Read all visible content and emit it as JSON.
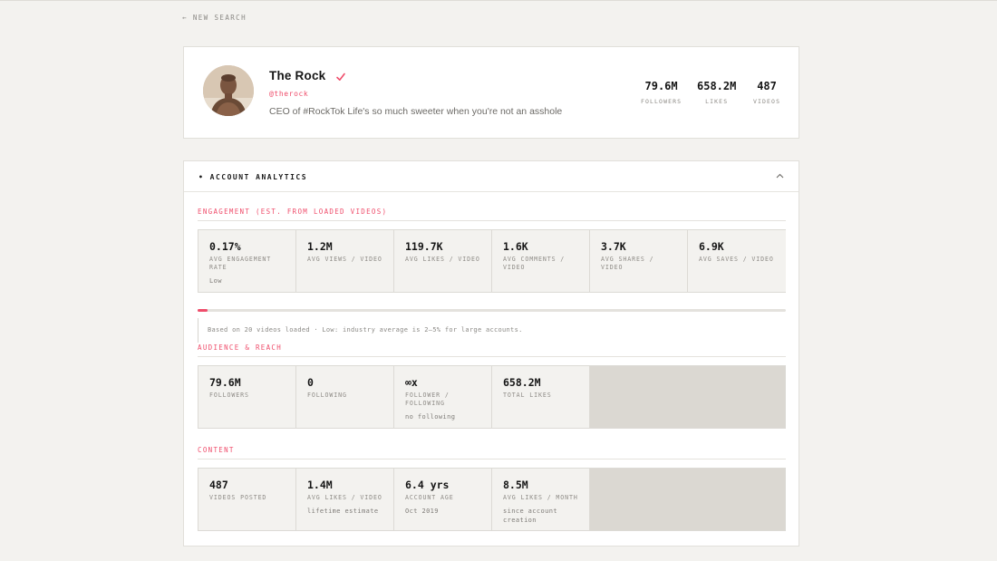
{
  "nav": {
    "back_label": "← NEW SEARCH"
  },
  "profile": {
    "name": "The Rock",
    "handle": "@therock",
    "bio": "CEO of #RockTok Life's so much sweeter when you're not an asshole",
    "verified_icon": "checkmark-icon",
    "stats": [
      {
        "value": "79.6M",
        "label": "FOLLOWERS"
      },
      {
        "value": "658.2M",
        "label": "LIKES"
      },
      {
        "value": "487",
        "label": "VIDEOS"
      }
    ]
  },
  "analytics": {
    "title": "• ACCOUNT ANALYTICS",
    "engagement": {
      "label": "ENGAGEMENT (EST. FROM LOADED VIDEOS)",
      "cells": [
        {
          "value": "0.17%",
          "label": "AVG ENGAGEMENT RATE",
          "sub": "Low"
        },
        {
          "value": "1.2M",
          "label": "AVG VIEWS / VIDEO",
          "sub": ""
        },
        {
          "value": "119.7K",
          "label": "AVG LIKES / VIDEO",
          "sub": ""
        },
        {
          "value": "1.6K",
          "label": "AVG COMMENTS / VIDEO",
          "sub": ""
        },
        {
          "value": "3.7K",
          "label": "AVG SHARES / VIDEO",
          "sub": ""
        },
        {
          "value": "6.9K",
          "label": "AVG SAVES / VIDEO",
          "sub": ""
        }
      ],
      "progress_fraction": 0.017,
      "note": "Based on 20 videos loaded · Low: industry average is 2–5% for large accounts."
    },
    "audience": {
      "label": "AUDIENCE & REACH",
      "cells": [
        {
          "value": "79.6M",
          "label": "FOLLOWERS",
          "sub": ""
        },
        {
          "value": "0",
          "label": "FOLLOWING",
          "sub": ""
        },
        {
          "value": "∞x",
          "label": "FOLLOWER / FOLLOWING",
          "sub": "no following"
        },
        {
          "value": "658.2M",
          "label": "TOTAL LIKES",
          "sub": ""
        }
      ]
    },
    "content": {
      "label": "CONTENT",
      "cells": [
        {
          "value": "487",
          "label": "VIDEOS POSTED",
          "sub": ""
        },
        {
          "value": "1.4M",
          "label": "AVG LIKES / VIDEO",
          "sub": "lifetime estimate"
        },
        {
          "value": "6.4 yrs",
          "label": "ACCOUNT AGE",
          "sub": "Oct 2019"
        },
        {
          "value": "8.5M",
          "label": "AVG LIKES / MONTH",
          "sub": "since account creation"
        }
      ]
    }
  },
  "colors": {
    "accent": "#ef4d6b",
    "background": "#f3f2ef",
    "filler": "#dbd8d2"
  }
}
